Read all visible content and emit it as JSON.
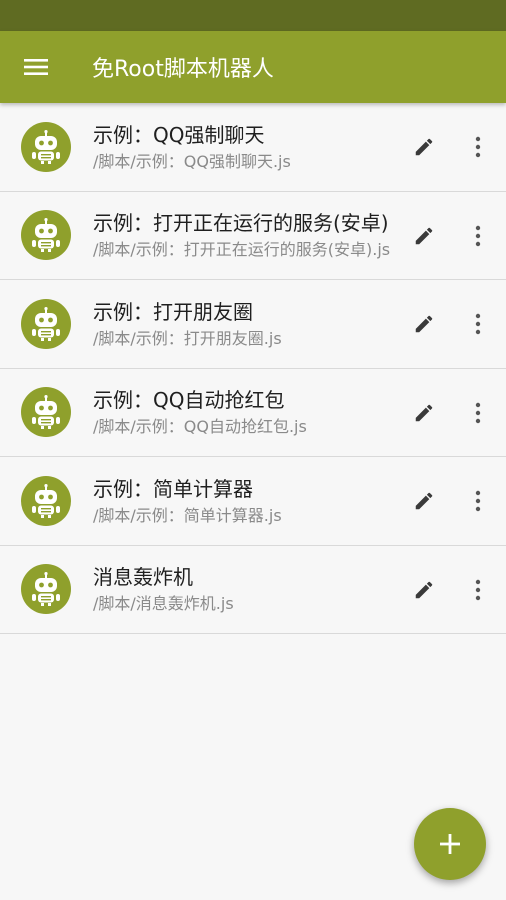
{
  "app_bar": {
    "menu_icon": "hamburger-menu-icon",
    "title": "免Root脚本机器人",
    "color": "#8fa02c"
  },
  "status_bar": {
    "color": "#5f6b22"
  },
  "scripts": [
    {
      "title": "示例：QQ强制聊天",
      "path": "/脚本/示例：QQ强制聊天.js",
      "icon": "android-robot-icon"
    },
    {
      "title": "示例：打开正在运行的服务(安卓)",
      "path": "/脚本/示例：打开正在运行的服务(安卓).js",
      "icon": "android-robot-icon"
    },
    {
      "title": "示例：打开朋友圈",
      "path": "/脚本/示例：打开朋友圈.js",
      "icon": "android-robot-icon"
    },
    {
      "title": "示例：QQ自动抢红包",
      "path": "/脚本/示例：QQ自动抢红包.js",
      "icon": "android-robot-icon"
    },
    {
      "title": "示例：简单计算器",
      "path": "/脚本/示例：简单计算器.js",
      "icon": "android-robot-icon"
    },
    {
      "title": "消息轰炸机",
      "path": "/脚本/消息轰炸机.js",
      "icon": "android-robot-icon"
    }
  ],
  "row_actions": {
    "edit_icon": "pencil-icon",
    "more_icon": "more-vert-icon"
  },
  "fab": {
    "icon": "plus-icon"
  }
}
